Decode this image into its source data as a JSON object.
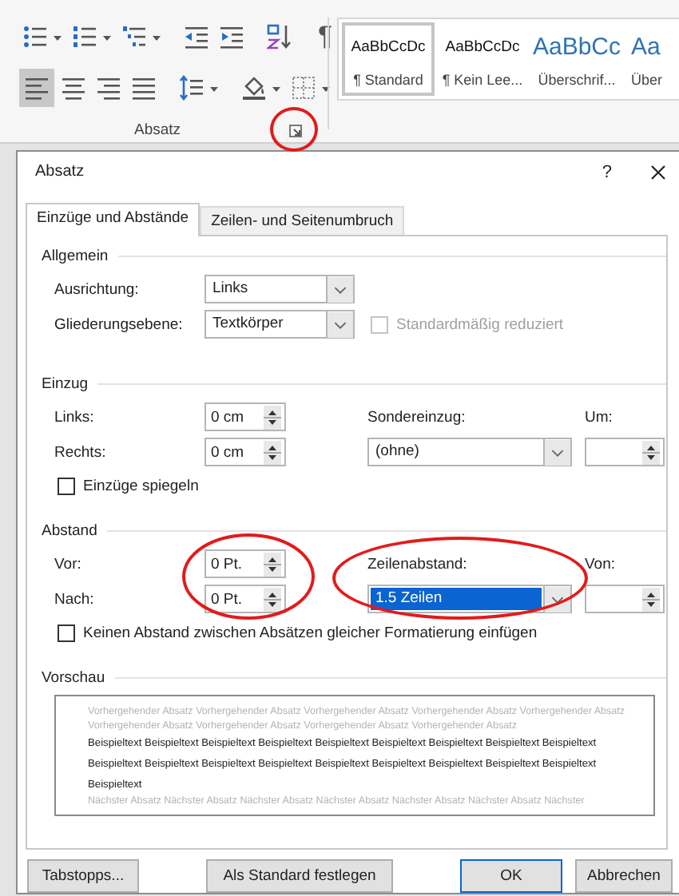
{
  "ribbon": {
    "tool_rows": [
      [
        {
          "kind": "bullets",
          "dropdown": true,
          "selected": false
        },
        {
          "kind": "numbering",
          "dropdown": true,
          "selected": false
        },
        {
          "kind": "multilevel",
          "dropdown": true,
          "selected": false
        },
        {
          "kind": "separator"
        },
        {
          "kind": "outdent",
          "dropdown": false,
          "selected": false
        },
        {
          "kind": "indent",
          "dropdown": false,
          "selected": false
        },
        {
          "kind": "separator"
        },
        {
          "kind": "sort",
          "dropdown": false,
          "selected": false
        },
        {
          "kind": "separator"
        },
        {
          "kind": "pilcrow",
          "glyph": "¶",
          "dropdown": false,
          "selected": false
        }
      ],
      [
        {
          "kind": "align-left",
          "dropdown": false,
          "selected": true
        },
        {
          "kind": "align-center",
          "dropdown": false,
          "selected": false
        },
        {
          "kind": "align-right",
          "dropdown": false,
          "selected": false
        },
        {
          "kind": "justify",
          "dropdown": false,
          "selected": false
        },
        {
          "kind": "separator"
        },
        {
          "kind": "line-spacing",
          "dropdown": true,
          "selected": false
        },
        {
          "kind": "separator"
        },
        {
          "kind": "shading",
          "dropdown": true,
          "selected": false
        },
        {
          "kind": "borders",
          "dropdown": true,
          "selected": false
        }
      ]
    ],
    "group_label": "Absatz",
    "launcher": {
      "circled": true
    },
    "styles": [
      {
        "kind": "normal",
        "sample": "AaBbCcDc",
        "name": "¶ Standard",
        "selected": true
      },
      {
        "kind": "normal",
        "sample": "AaBbCcDc",
        "name": "¶ Kein Lee...",
        "selected": false
      },
      {
        "kind": "heading",
        "sample": "AaBbCc",
        "name": "Überschrif...",
        "selected": false
      },
      {
        "kind": "heading",
        "sample": "Aa",
        "name": "Über",
        "selected": false
      }
    ]
  },
  "dialog": {
    "title": "Absatz",
    "help": "?",
    "tabs": [
      {
        "label": "Einzüge und Abstände",
        "selected": true
      },
      {
        "label": "Zeilen- und Seitenumbruch",
        "selected": false
      }
    ],
    "general": {
      "title": "Allgemein",
      "alignment": {
        "label": "Ausrichtung:",
        "value": "Links"
      },
      "outline_level": {
        "label": "Gliederungsebene:",
        "value": "Textkörper"
      },
      "collapsed": {
        "label": "Standardmäßig reduziert",
        "checked": false,
        "disabled": true
      }
    },
    "indent": {
      "title": "Einzug",
      "left": {
        "label": "Links:",
        "value": "0 cm"
      },
      "right": {
        "label": "Rechts:",
        "value": "0 cm"
      },
      "special": {
        "label": "Sondereinzug:",
        "value": "(ohne)"
      },
      "by": {
        "label": "Um:"
      },
      "mirror": {
        "label": "Einzüge spiegeln",
        "checked": false,
        "disabled": false
      }
    },
    "spacing": {
      "title": "Abstand",
      "before": {
        "label": "Vor:",
        "value": "0 Pt."
      },
      "after": {
        "label": "Nach:",
        "value": "0 Pt."
      },
      "fields_circled": true,
      "line_spacing": {
        "label": "Zeilenabstand:",
        "value": "1.5 Zeilen",
        "focused": true,
        "circled": true
      },
      "at": {
        "label": "Von:"
      },
      "no_space": {
        "label": "Keinen Abstand zwischen Absätzen gleicher Formatierung einfügen",
        "checked": false,
        "disabled": false
      }
    },
    "preview": {
      "title": "Vorschau",
      "previous": "Vorhergehender Absatz Vorhergehender Absatz Vorhergehender Absatz Vorhergehender Absatz Vorhergehender Absatz Vorhergehender Absatz Vorhergehender Absatz Vorhergehender Absatz Vorhergehender Absatz",
      "sample": "Beispieltext Beispieltext Beispieltext Beispieltext Beispieltext Beispieltext Beispieltext Beispieltext Beispieltext Beispieltext Beispieltext Beispieltext Beispieltext Beispieltext Beispieltext Beispieltext Beispieltext Beispieltext Beispieltext",
      "next": "Nächster Absatz Nächster Absatz Nächster Absatz Nächster Absatz Nächster Absatz Nächster Absatz Nächster"
    },
    "buttons": [
      {
        "label": "Tabstopps...",
        "default": false
      },
      {
        "label": "Als Standard festlegen",
        "default": false
      },
      {
        "label": "OK",
        "default": true
      },
      {
        "label": "Abbrechen",
        "default": false
      }
    ]
  }
}
